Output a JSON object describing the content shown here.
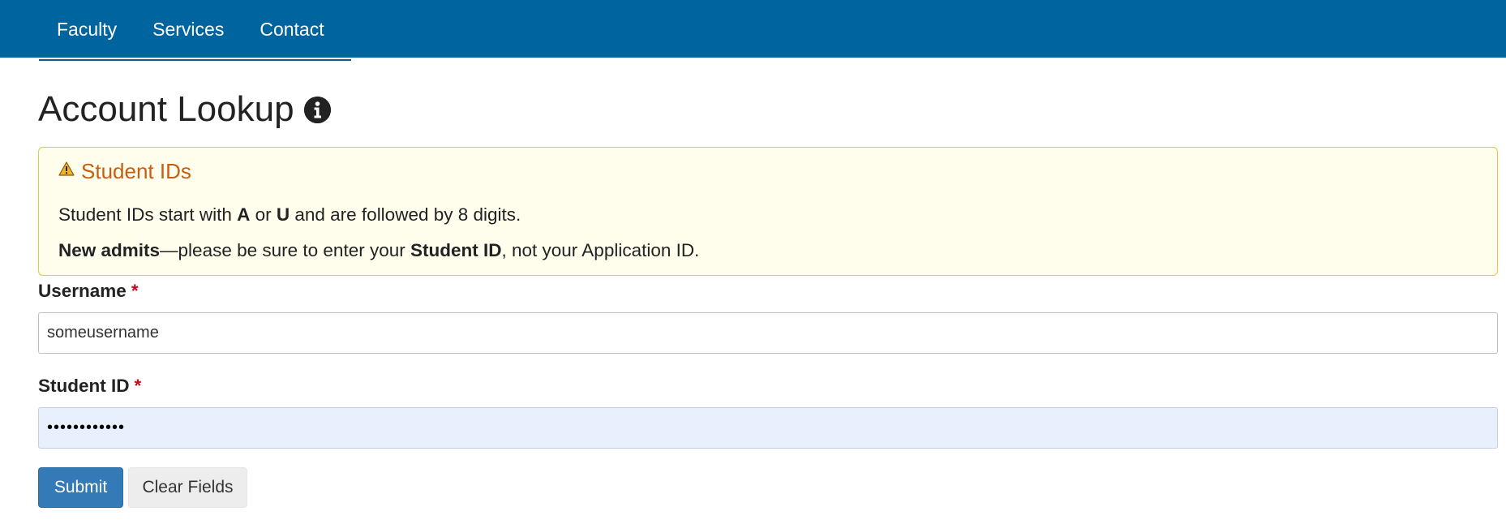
{
  "nav": {
    "items": [
      {
        "label": "Faculty"
      },
      {
        "label": "Services"
      },
      {
        "label": "Contact"
      }
    ]
  },
  "page": {
    "title": "Account Lookup",
    "info_icon": "info-circle-icon"
  },
  "alert": {
    "icon": "warning-triangle-icon",
    "heading": "Student IDs",
    "line1": {
      "part1": "Student IDs start with ",
      "bold1": "A",
      "part2": " or ",
      "bold2": "U",
      "part3": " and are followed by 8 digits."
    },
    "line2": {
      "bold1": "New admits",
      "part1": "—please be sure to enter your ",
      "bold2": "Student ID",
      "part2": ", not your Application ID."
    },
    "colors": {
      "background": "#fffeec",
      "border": "#f0c14b",
      "heading": "#c65f11"
    }
  },
  "form": {
    "username": {
      "label": "Username",
      "required_marker": "*",
      "value": "someusername"
    },
    "student_id": {
      "label": "Student ID",
      "required_marker": "*",
      "value": "••••••••••••"
    },
    "submit_label": "Submit",
    "clear_label": "Clear Fields"
  },
  "colors": {
    "header_bg": "#00649e",
    "primary_button": "#337ab7",
    "required": "#d0021b"
  }
}
